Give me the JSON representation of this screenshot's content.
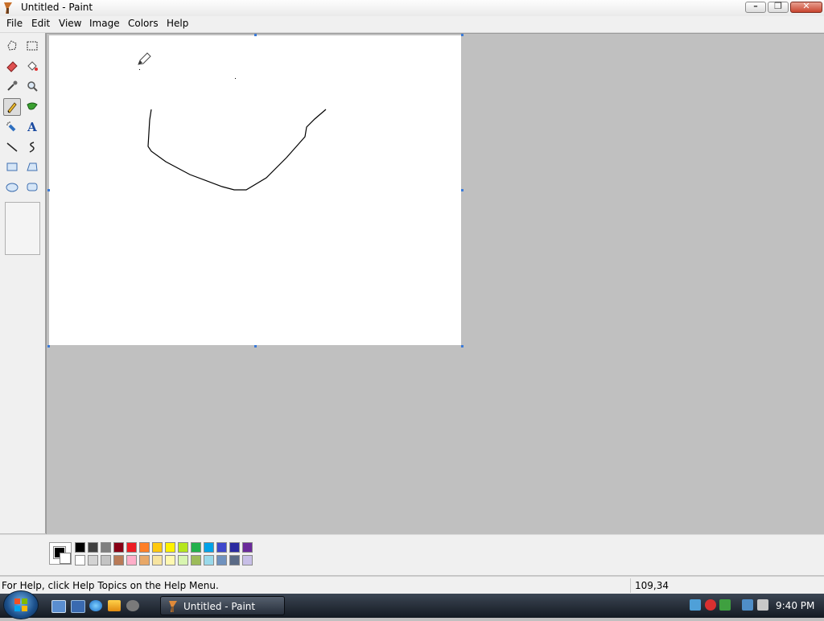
{
  "window": {
    "title": "Untitled - Paint",
    "minimize_glyph": "–",
    "maximize_glyph": "❐",
    "close_glyph": "✕"
  },
  "menu": [
    "File",
    "Edit",
    "View",
    "Image",
    "Colors",
    "Help"
  ],
  "toolbox": {
    "tools": [
      {
        "name": "free-form-select-icon"
      },
      {
        "name": "select-icon"
      },
      {
        "name": "eraser-icon"
      },
      {
        "name": "fill-bucket-icon"
      },
      {
        "name": "color-picker-icon"
      },
      {
        "name": "magnifier-icon"
      },
      {
        "name": "pencil-icon",
        "selected": true
      },
      {
        "name": "brush-icon"
      },
      {
        "name": "airbrush-icon"
      },
      {
        "name": "text-icon",
        "glyph": "A"
      },
      {
        "name": "line-icon"
      },
      {
        "name": "curve-icon"
      },
      {
        "name": "rectangle-icon"
      },
      {
        "name": "polygon-icon"
      },
      {
        "name": "ellipse-icon"
      },
      {
        "name": "rounded-rectangle-icon"
      }
    ]
  },
  "palette": {
    "foreground": "#000000",
    "background": "#ffffff",
    "colors_top": [
      "#000000",
      "#404040",
      "#7f7f7f",
      "#880015",
      "#ed1c24",
      "#ff7f27",
      "#ffc90e",
      "#fff200",
      "#b5e61d",
      "#22b14c",
      "#00a2e8",
      "#3f48cc",
      "#2a2aa0",
      "#6a2a9a"
    ],
    "colors_bottom": [
      "#ffffff",
      "#d3d3d3",
      "#c3c3c3",
      "#b97a57",
      "#ffaec9",
      "#e8a868",
      "#f7e4a0",
      "#fff8b0",
      "#d8f5b0",
      "#9cbb5a",
      "#99d9ea",
      "#7092be",
      "#5a6a86",
      "#c8bfe7"
    ]
  },
  "status": {
    "help_text": "For Help, click Help Topics on the Help Menu.",
    "coordinates": "109,34"
  },
  "taskbar": {
    "task_label": "Untitled - Paint",
    "clock": "9:40 PM"
  }
}
